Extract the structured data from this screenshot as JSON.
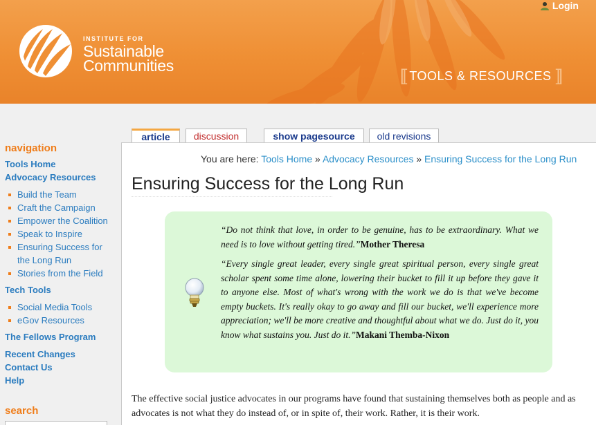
{
  "header": {
    "logo_small": "INSTITUTE FOR",
    "logo_line1": "Sustainable",
    "logo_line2": "Communities",
    "login_label": "Login",
    "banner_label": "TOOLS & RESOURCES",
    "bracket_open": "[[",
    "bracket_close": "]]"
  },
  "tabs": {
    "article": "article",
    "discussion": "discussion",
    "show_pagesource": "show pagesource",
    "old_revisions": "old revisions"
  },
  "sidebar": {
    "nav_title": "navigation",
    "tools_home": "Tools Home",
    "advocacy_resources": "Advocacy Resources",
    "advocacy_items": [
      "Build the Team",
      "Craft the Campaign",
      "Empower the Coalition",
      "Speak to Inspire",
      "Ensuring Success for the Long Run",
      "Stories from the Field"
    ],
    "tech_tools": "Tech Tools",
    "tech_items": [
      "Social Media Tools",
      "eGov Resources"
    ],
    "fellows_program": "The Fellows Program",
    "recent_changes": "Recent Changes",
    "contact_us": "Contact Us",
    "help": "Help",
    "search_title": "search"
  },
  "breadcrumb": {
    "prefix": "You are here:",
    "items": [
      "Tools Home",
      "Advocacy Resources",
      "Ensuring Success for the Long Run"
    ],
    "separator": "»"
  },
  "page": {
    "title": "Ensuring Success for the Long Run",
    "quote1_text": "“Do not think that love, in order to be genuine, has to be extraordinary. What we need is to love without getting tired.”",
    "quote1_author": "Mother Theresa",
    "quote2_text": "“Every single great leader, every single great spiritual person, every single great scholar spent some time alone, lowering their bucket to fill it up before they gave it to anyone else. Most of what's wrong with the work we do is that we've become empty buckets. It's really okay to go away and fill our bucket, we'll experience more appreciation; we'll be more creative and thoughtful about what we do. Just do it, you know what sustains you. Just do it.”",
    "quote2_author": "Makani Themba-Nixon",
    "body": "The effective social justice advocates in our programs have found that sustaining themselves both as people and as advocates is not what they do instead of, or in spite of, their work. Rather, it is their work."
  },
  "colors": {
    "header_orange": "#ef8f34",
    "nav_orange": "#ef7d1a",
    "link_blue": "#2b7cbf",
    "quote_green": "#dcf8d8"
  }
}
